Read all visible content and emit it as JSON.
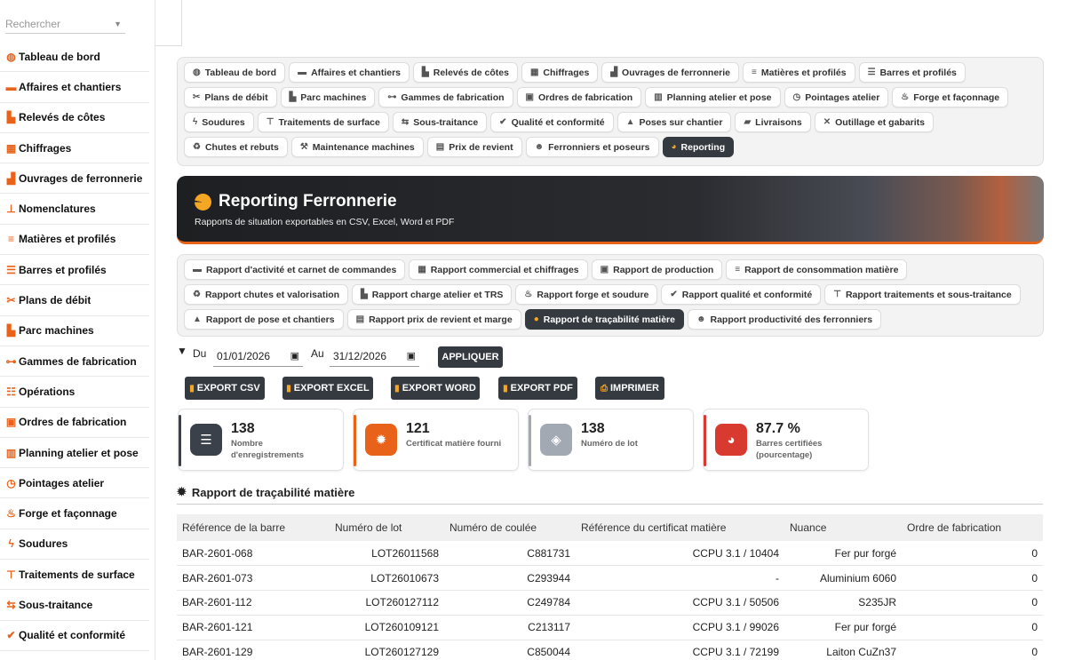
{
  "sidebar": {
    "search_placeholder": "Rechercher",
    "items": [
      {
        "label": "Tableau de bord",
        "icon": "◍"
      },
      {
        "label": "Affaires et chantiers",
        "icon": "▬"
      },
      {
        "label": "Relevés de côtes",
        "icon": "▙"
      },
      {
        "label": "Chiffrages",
        "icon": "▦"
      },
      {
        "label": "Ouvrages de ferronnerie",
        "icon": "▟"
      },
      {
        "label": "Nomenclatures",
        "icon": "⊥"
      },
      {
        "label": "Matières et profilés",
        "icon": "≡"
      },
      {
        "label": "Barres et profilés",
        "icon": "☰"
      },
      {
        "label": "Plans de débit",
        "icon": "✂"
      },
      {
        "label": "Parc machines",
        "icon": "▙"
      },
      {
        "label": "Gammes de fabrication",
        "icon": "⊶"
      },
      {
        "label": "Opérations",
        "icon": "☷"
      },
      {
        "label": "Ordres de fabrication",
        "icon": "▣"
      },
      {
        "label": "Planning atelier et pose",
        "icon": "▥"
      },
      {
        "label": "Pointages atelier",
        "icon": "◷"
      },
      {
        "label": "Forge et façonnage",
        "icon": "♨"
      },
      {
        "label": "Soudures",
        "icon": "ϟ"
      },
      {
        "label": "Traitements de surface",
        "icon": "⊤"
      },
      {
        "label": "Sous-traitance",
        "icon": "⇆"
      },
      {
        "label": "Qualité et conformité",
        "icon": "✔"
      }
    ]
  },
  "module_tabs": [
    {
      "label": "Tableau de bord",
      "icon": "◍"
    },
    {
      "label": "Affaires et chantiers",
      "icon": "▬"
    },
    {
      "label": "Relevés de côtes",
      "icon": "▙"
    },
    {
      "label": "Chiffrages",
      "icon": "▦"
    },
    {
      "label": "Ouvrages de ferronnerie",
      "icon": "▟"
    },
    {
      "label": "Matières et profilés",
      "icon": "≡"
    },
    {
      "label": "Barres et profilés",
      "icon": "☰"
    },
    {
      "label": "Plans de débit",
      "icon": "✂"
    },
    {
      "label": "Parc machines",
      "icon": "▙"
    },
    {
      "label": "Gammes de fabrication",
      "icon": "⊶"
    },
    {
      "label": "Ordres de fabrication",
      "icon": "▣"
    },
    {
      "label": "Planning atelier et pose",
      "icon": "▥"
    },
    {
      "label": "Pointages atelier",
      "icon": "◷"
    },
    {
      "label": "Forge et façonnage",
      "icon": "♨"
    },
    {
      "label": "Soudures",
      "icon": "ϟ"
    },
    {
      "label": "Traitements de surface",
      "icon": "⊤"
    },
    {
      "label": "Sous-traitance",
      "icon": "⇆"
    },
    {
      "label": "Qualité et conformité",
      "icon": "✔"
    },
    {
      "label": "Poses sur chantier",
      "icon": "▲"
    },
    {
      "label": "Livraisons",
      "icon": "▰"
    },
    {
      "label": "Outillage et gabarits",
      "icon": "✕"
    },
    {
      "label": "Chutes et rebuts",
      "icon": "♻"
    },
    {
      "label": "Maintenance machines",
      "icon": "⚒"
    },
    {
      "label": "Prix de revient",
      "icon": "▤"
    },
    {
      "label": "Ferronniers et poseurs",
      "icon": "☻"
    },
    {
      "label": "Reporting",
      "icon": "◕",
      "active": true
    }
  ],
  "hero": {
    "title": "Reporting Ferronnerie",
    "subtitle": "Rapports de situation exportables en CSV, Excel, Word et PDF"
  },
  "report_tabs": [
    {
      "label": "Rapport d'activité et carnet de commandes",
      "icon": "▬"
    },
    {
      "label": "Rapport commercial et chiffrages",
      "icon": "▦"
    },
    {
      "label": "Rapport de production",
      "icon": "▣"
    },
    {
      "label": "Rapport de consommation matière",
      "icon": "≡"
    },
    {
      "label": "Rapport chutes et valorisation",
      "icon": "♻"
    },
    {
      "label": "Rapport charge atelier et TRS",
      "icon": "▙"
    },
    {
      "label": "Rapport forge et soudure",
      "icon": "♨"
    },
    {
      "label": "Rapport qualité et conformité",
      "icon": "✔"
    },
    {
      "label": "Rapport traitements et sous-traitance",
      "icon": "⊤"
    },
    {
      "label": "Rapport de pose et chantiers",
      "icon": "▲"
    },
    {
      "label": "Rapport prix de revient et marge",
      "icon": "▤"
    },
    {
      "label": "Rapport de traçabilité matière",
      "icon": "●",
      "active": true
    },
    {
      "label": "Rapport productivité des ferronniers",
      "icon": "☻"
    }
  ],
  "filters": {
    "from_label": "Du",
    "from_value": "01/01/2026",
    "to_label": "Au",
    "to_value": "31/12/2026",
    "apply_label": "APPLIQUER"
  },
  "exports": {
    "csv": "EXPORT CSV",
    "excel": "EXPORT EXCEL",
    "word": "EXPORT WORD",
    "pdf": "EXPORT PDF",
    "print": "IMPRIMER"
  },
  "stats": [
    {
      "value": "138",
      "label": "Nombre d'enregistrements",
      "color": "#3b414a",
      "accent": "#3b414a"
    },
    {
      "value": "121",
      "label": "Certificat matière fourni",
      "color": "#e8621a",
      "accent": "#e8621a"
    },
    {
      "value": "138",
      "label": "Numéro de lot",
      "color": "#a3a9b3",
      "accent": "#a3a9b3"
    },
    {
      "value": "87.7 %",
      "label": "Barres certifiées (pourcentage)",
      "color": "#d93a2f",
      "accent": "#d93a2f"
    }
  ],
  "section_title": "Rapport de traçabilité matière",
  "table": {
    "headers": [
      "Référence de la barre",
      "Numéro de lot",
      "Numéro de coulée",
      "Référence du certificat matière",
      "Nuance",
      "Ordre de fabrication"
    ],
    "rows": [
      [
        "BAR-2601-068",
        "LOT26011568",
        "C881731",
        "CCPU 3.1 / 10404",
        "Fer pur forgé",
        "0"
      ],
      [
        "BAR-2601-073",
        "LOT26010673",
        "C293944",
        "-",
        "Aluminium 6060",
        "0"
      ],
      [
        "BAR-2601-112",
        "LOT260127112",
        "C249784",
        "CCPU 3.1 / 50506",
        "S235JR",
        "0"
      ],
      [
        "BAR-2601-121",
        "LOT260109121",
        "C213117",
        "CCPU 3.1 / 99026",
        "Fer pur forgé",
        "0"
      ],
      [
        "BAR-2601-129",
        "LOT260127129",
        "C850044",
        "CCPU 3.1 / 72199",
        "Laiton CuZn37",
        "0"
      ]
    ]
  }
}
